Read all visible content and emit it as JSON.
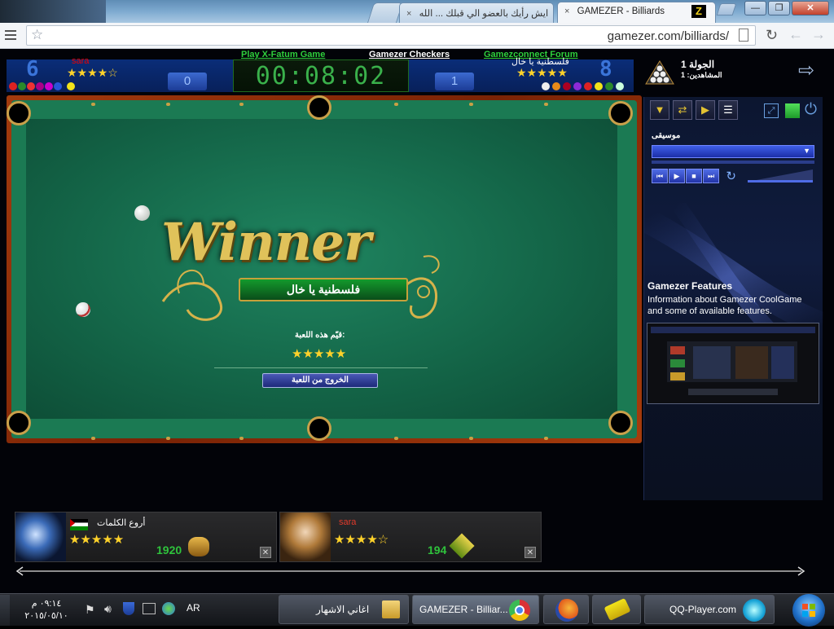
{
  "browser": {
    "tabs": [
      {
        "label": ""
      },
      {
        "label": "ايش رأيك بالعضو الي قبلك ... الله"
      },
      {
        "label": "GAMEZER - Billiards"
      }
    ],
    "close_symbol": "×",
    "url": "gamezer.com/billiards/",
    "window_buttons": [
      "—",
      "❐",
      "✕"
    ]
  },
  "game": {
    "links": [
      "Play X-Fatum Game",
      "Gamezer Checkers",
      "Gamezconnect Forum"
    ],
    "left_player": {
      "name": "sara",
      "big_number": "6",
      "score": "0",
      "rating": "★★★★☆"
    },
    "right_player": {
      "name": "فلسطنية يا خال",
      "big_number": "8",
      "score": "1",
      "rating": "★★★★★"
    },
    "timer": "00:08:02",
    "round_label": "الجولة 1",
    "viewers_label": "المشاهدين: 1",
    "winner_title": "Winner",
    "winner_name": "فلسطنية يا خال",
    "rate_label": "قيّم هذه اللعبة:",
    "rate_stars": "★★★★★",
    "exit_label": "الخروج من اللعبة"
  },
  "side_panel": {
    "music_label": "موسيقى",
    "features_title": "Gamezer Features",
    "features_desc": "Information about Gamezer CoolGame and some of available features."
  },
  "cards": [
    {
      "name": "أروع الكلمات",
      "stars": "★★★★★",
      "score": "1920",
      "name_color": "#ffffff"
    },
    {
      "name": "sara",
      "stars": "★★★★☆",
      "score": "194",
      "name_color": "#e23a2a"
    }
  ],
  "taskbar": {
    "clock_time": "٠٩:١٤ م",
    "clock_date": "٢٠١٥/٠٥/١٠",
    "lang": "AR",
    "items": [
      "اغاني الاشهار",
      "GAMEZER - Billiar...",
      "",
      "",
      "QQ-Player.com"
    ]
  },
  "colors": {
    "felt": "#1b7a53",
    "rail": "#8a2a07",
    "accent_gold": "#e0c25a",
    "timer_green": "#3ab14b"
  },
  "icons": [
    "star-icon",
    "back-icon",
    "forward-icon",
    "reload-icon",
    "page-icon",
    "menu-icon",
    "exit-icon",
    "start-orb-icon",
    "folder-icon",
    "chrome-icon",
    "firefox-icon",
    "volume-icon",
    "flag-icon",
    "network-icon"
  ]
}
